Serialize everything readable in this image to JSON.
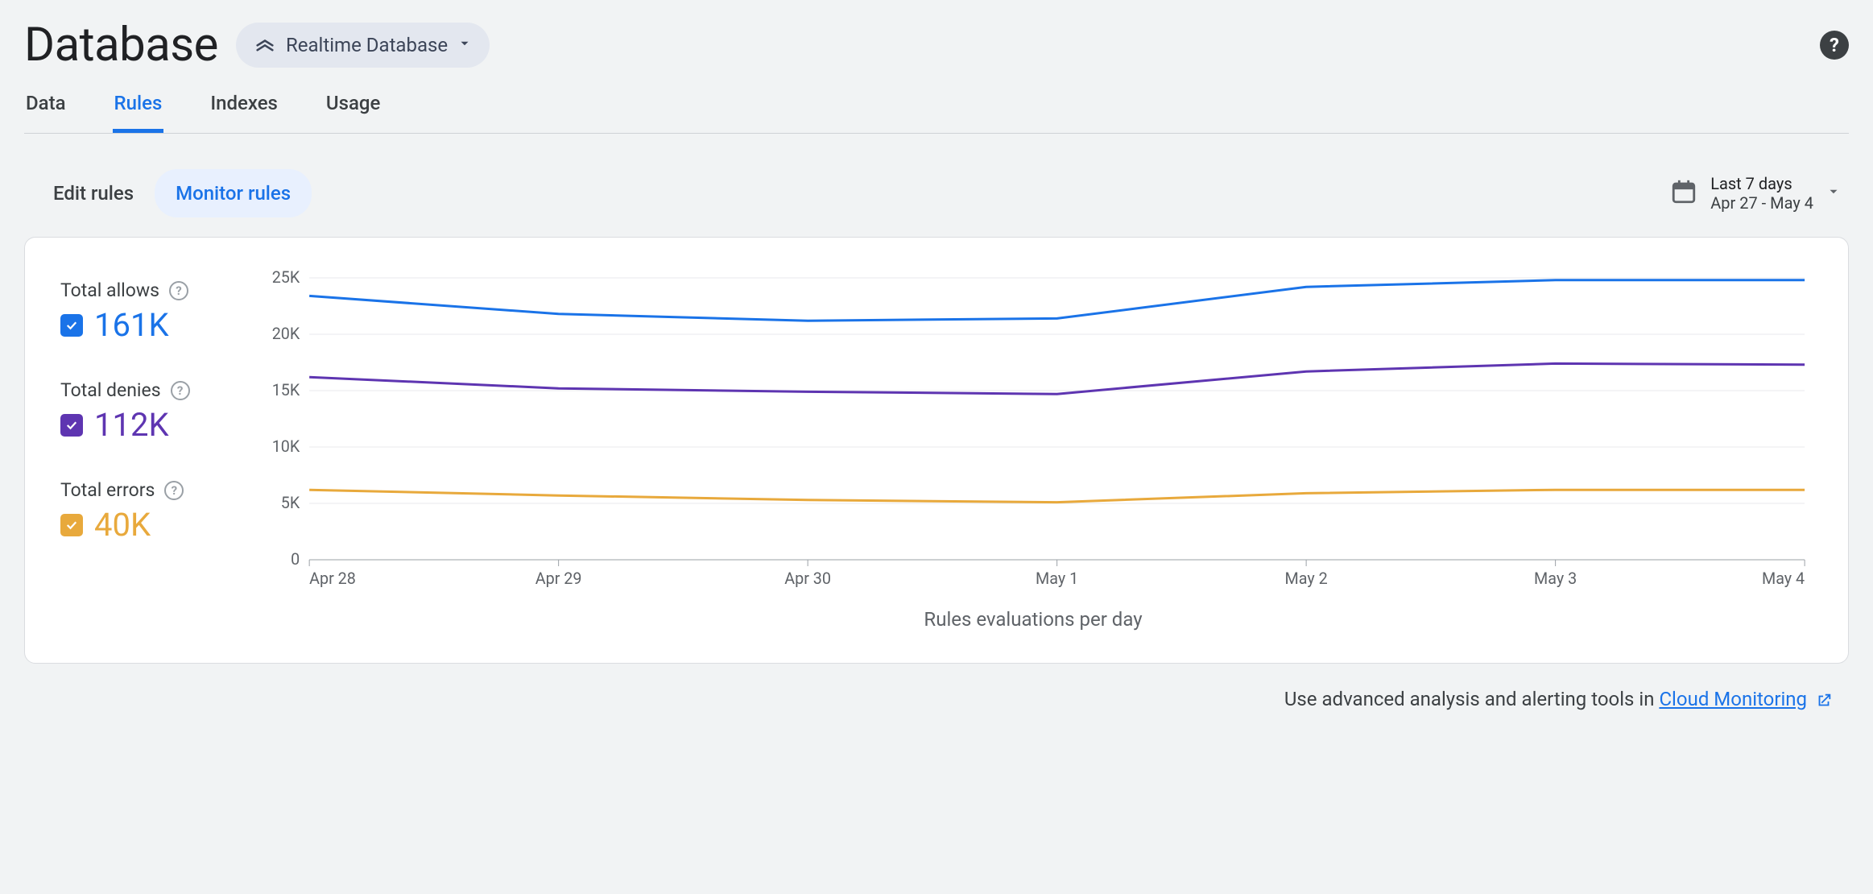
{
  "header": {
    "title": "Database",
    "selector_label": "Realtime Database"
  },
  "tabs": [
    "Data",
    "Rules",
    "Indexes",
    "Usage"
  ],
  "active_tab": "Rules",
  "subtabs": [
    "Edit rules",
    "Monitor rules"
  ],
  "active_subtab": "Monitor rules",
  "date_picker": {
    "range_label": "Last 7 days",
    "range_dates": "Apr 27 - May 4"
  },
  "legend": {
    "allows": {
      "label": "Total allows",
      "value": "161K",
      "color": "#1a73e8"
    },
    "denies": {
      "label": "Total denies",
      "value": "112K",
      "color": "#5e35b1"
    },
    "errors": {
      "label": "Total errors",
      "value": "40K",
      "color": "#e8a93c"
    }
  },
  "chart_data": {
    "type": "line",
    "title": "",
    "xlabel": "Rules evaluations per day",
    "ylabel": "",
    "ylim": [
      0,
      25000
    ],
    "yticks": [
      0,
      5000,
      10000,
      15000,
      20000,
      25000
    ],
    "ytick_labels": [
      "0",
      "5K",
      "10K",
      "15K",
      "20K",
      "25K"
    ],
    "categories": [
      "Apr 28",
      "Apr 29",
      "Apr 30",
      "May 1",
      "May 2",
      "May 3",
      "May 4"
    ],
    "series": [
      {
        "name": "Total allows",
        "color": "#1a73e8",
        "values": [
          23400,
          21800,
          21200,
          21400,
          24200,
          24800,
          24800
        ]
      },
      {
        "name": "Total denies",
        "color": "#5e35b1",
        "values": [
          16200,
          15200,
          14900,
          14700,
          16700,
          17400,
          17300
        ]
      },
      {
        "name": "Total errors",
        "color": "#e8a93c",
        "values": [
          6200,
          5700,
          5300,
          5100,
          5900,
          6200,
          6200
        ]
      }
    ]
  },
  "footer": {
    "text_prefix": "Use advanced analysis and alerting tools in ",
    "link_text": "Cloud Monitoring"
  }
}
